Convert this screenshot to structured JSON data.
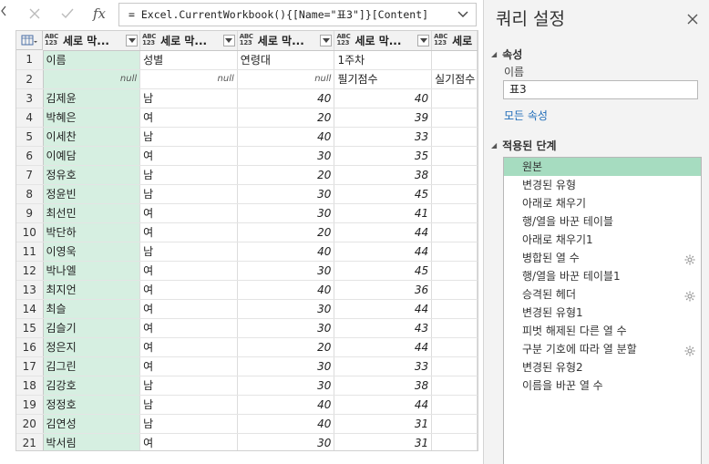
{
  "formula_bar": {
    "expression": "= Excel.CurrentWorkbook(){[Name=\"표3\"]}[Content]",
    "fx_label": "fx"
  },
  "table": {
    "columns": [
      {
        "type": "ABC\n123",
        "name": "세로 막..."
      },
      {
        "type": "ABC\n123",
        "name": "세로 막..."
      },
      {
        "type": "ABC\n123",
        "name": "세로 막..."
      },
      {
        "type": "ABC\n123",
        "name": "세로 막..."
      },
      {
        "type": "ABC\n123",
        "name": "세로"
      }
    ],
    "rows": [
      {
        "n": "1",
        "c": [
          "이름",
          "성별",
          "연령대",
          "1주차",
          ""
        ]
      },
      {
        "n": "2",
        "c": [
          "null",
          "null",
          "null",
          "필기점수",
          "실기점수"
        ]
      },
      {
        "n": "3",
        "c": [
          "김제윤",
          "남",
          "40",
          "40",
          ""
        ]
      },
      {
        "n": "4",
        "c": [
          "박혜은",
          "여",
          "20",
          "39",
          ""
        ]
      },
      {
        "n": "5",
        "c": [
          "이세찬",
          "남",
          "40",
          "33",
          ""
        ]
      },
      {
        "n": "6",
        "c": [
          "이예담",
          "여",
          "30",
          "35",
          ""
        ]
      },
      {
        "n": "7",
        "c": [
          "정유호",
          "남",
          "20",
          "38",
          ""
        ]
      },
      {
        "n": "8",
        "c": [
          "정윤빈",
          "남",
          "30",
          "45",
          ""
        ]
      },
      {
        "n": "9",
        "c": [
          "최선민",
          "여",
          "30",
          "41",
          ""
        ]
      },
      {
        "n": "10",
        "c": [
          "박단하",
          "여",
          "20",
          "44",
          ""
        ]
      },
      {
        "n": "11",
        "c": [
          "이영욱",
          "남",
          "40",
          "44",
          ""
        ]
      },
      {
        "n": "12",
        "c": [
          "박나엘",
          "여",
          "30",
          "45",
          ""
        ]
      },
      {
        "n": "13",
        "c": [
          "최지언",
          "여",
          "40",
          "36",
          ""
        ]
      },
      {
        "n": "14",
        "c": [
          "최슬",
          "여",
          "30",
          "44",
          ""
        ]
      },
      {
        "n": "15",
        "c": [
          "김슬기",
          "여",
          "30",
          "43",
          ""
        ]
      },
      {
        "n": "16",
        "c": [
          "정은지",
          "여",
          "20",
          "44",
          ""
        ]
      },
      {
        "n": "17",
        "c": [
          "김그린",
          "여",
          "30",
          "33",
          ""
        ]
      },
      {
        "n": "18",
        "c": [
          "김강호",
          "남",
          "30",
          "38",
          ""
        ]
      },
      {
        "n": "19",
        "c": [
          "정정호",
          "남",
          "40",
          "44",
          ""
        ]
      },
      {
        "n": "20",
        "c": [
          "김연성",
          "남",
          "40",
          "31",
          ""
        ]
      },
      {
        "n": "21",
        "c": [
          "박서림",
          "여",
          "30",
          "31",
          ""
        ]
      }
    ]
  },
  "panel": {
    "title": "쿼리 설정",
    "properties_header": "속성",
    "name_label": "이름",
    "name_value": "표3",
    "all_properties_link": "모든 속성",
    "steps_header": "적용된 단계",
    "steps": [
      {
        "label": "원본",
        "gear": false,
        "selected": true
      },
      {
        "label": "변경된 유형",
        "gear": false
      },
      {
        "label": "아래로 채우기",
        "gear": false
      },
      {
        "label": "행/열을 바꾼 테이블",
        "gear": false
      },
      {
        "label": "아래로 채우기1",
        "gear": false
      },
      {
        "label": "병합된 열 수",
        "gear": true
      },
      {
        "label": "행/열을 바꾼 테이블1",
        "gear": false
      },
      {
        "label": "승격된 헤더",
        "gear": true
      },
      {
        "label": "변경된 유형1",
        "gear": false
      },
      {
        "label": "피벗 해제된 다른 열 수",
        "gear": false
      },
      {
        "label": "구분 기호에 따라 열 분할",
        "gear": true
      },
      {
        "label": "변경된 유형2",
        "gear": false
      },
      {
        "label": "이름을 바꾼 열 수",
        "gear": false
      }
    ]
  },
  "colors": {
    "selected_column": "#d6efe1",
    "selected_step": "#a6dcc0",
    "link": "#1e6bb8"
  }
}
